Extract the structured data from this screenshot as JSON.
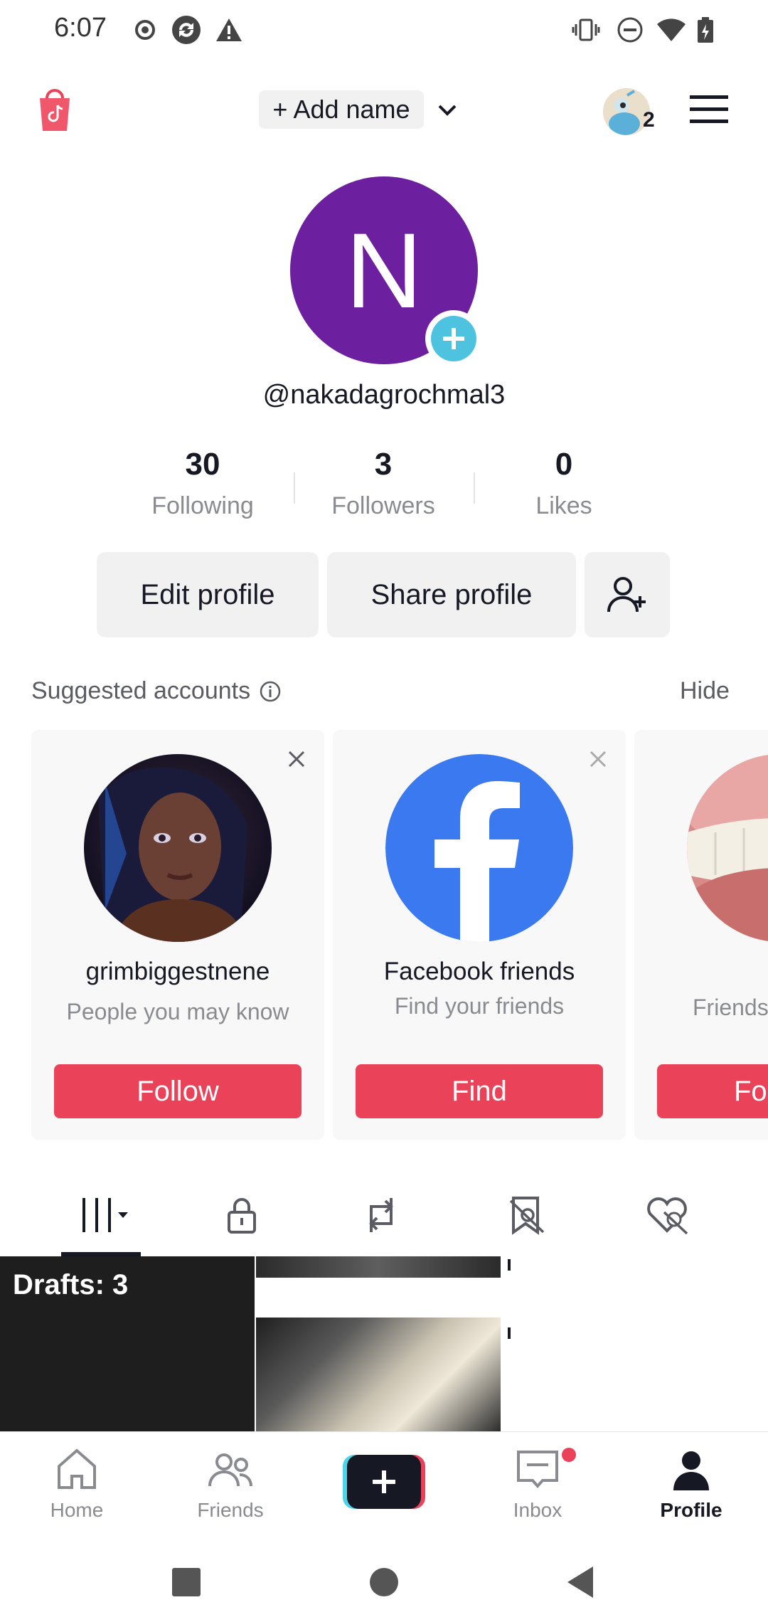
{
  "status_bar": {
    "time": "6:07",
    "left_icons": [
      "record-icon",
      "sync-icon",
      "warning-icon"
    ],
    "right_icons": [
      "vibrate-icon",
      "dnd-icon",
      "wifi-icon",
      "battery-icon"
    ]
  },
  "header": {
    "add_name": "+ Add name",
    "notification_count": "2",
    "icons": [
      "shop-icon",
      "chevron-down-icon",
      "avatar-icon",
      "menu-icon"
    ]
  },
  "profile": {
    "avatar_letter": "N",
    "username": "@nakadagrochmal3",
    "stats": [
      {
        "value": "30",
        "label": "Following"
      },
      {
        "value": "3",
        "label": "Followers"
      },
      {
        "value": "0",
        "label": "Likes"
      }
    ],
    "edit_profile": "Edit profile",
    "share_profile": "Share profile"
  },
  "suggested": {
    "title": "Suggested accounts",
    "hide": "Hide",
    "cards": [
      {
        "name": "grimbiggestnene",
        "subtitle": "People you may know",
        "button": "Follow"
      },
      {
        "name": "Facebook friends",
        "subtitle": "Find your friends",
        "button": "Find"
      },
      {
        "name": "",
        "subtitle": "Friends",
        "button": "Fo"
      }
    ]
  },
  "content_tabs": [
    "videos-icon",
    "lock-icon",
    "repost-icon",
    "favorites-icon",
    "liked-icon"
  ],
  "grid": {
    "drafts_label": "Drafts: 3"
  },
  "bottom_nav": {
    "items": [
      {
        "label": "Home",
        "icon": "home-icon"
      },
      {
        "label": "Friends",
        "icon": "friends-icon"
      },
      {
        "label": "",
        "icon": "create-icon"
      },
      {
        "label": "Inbox",
        "icon": "inbox-icon"
      },
      {
        "label": "Profile",
        "icon": "profile-icon"
      }
    ]
  },
  "colors": {
    "accent_red": "#ea4359",
    "avatar_purple": "#6c1f9e",
    "plus_cyan": "#4dc3e0",
    "facebook_blue": "#3b79f0"
  }
}
